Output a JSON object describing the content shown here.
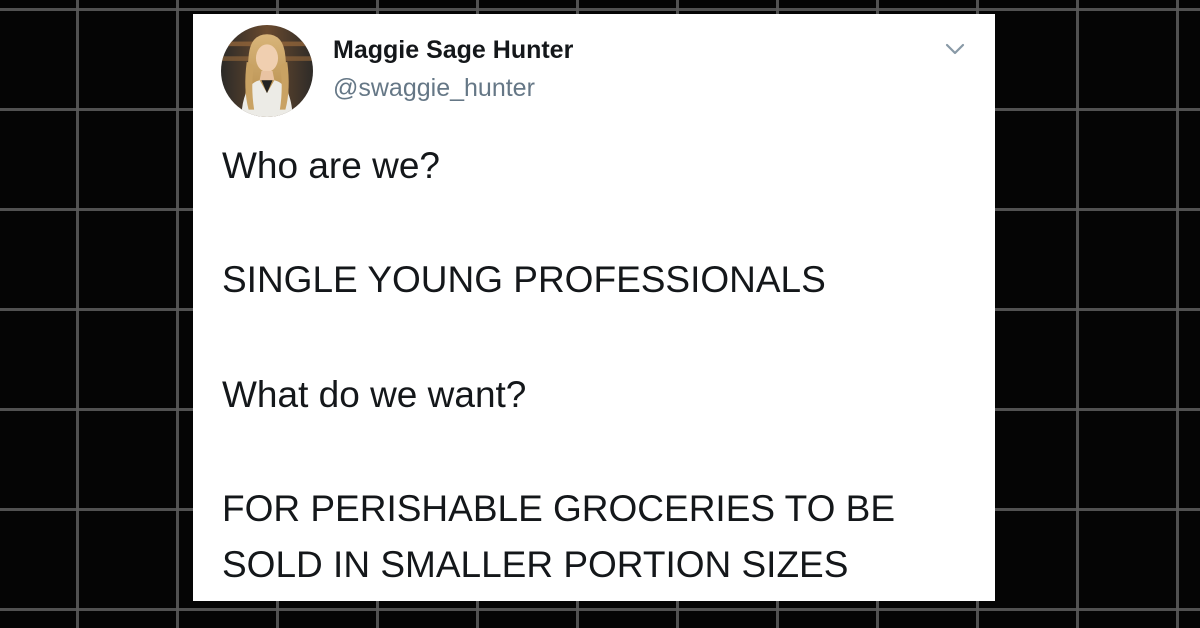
{
  "tweet": {
    "author": {
      "display_name": "Maggie Sage Hunter",
      "handle": "@swaggie_hunter"
    },
    "icons": {
      "avatar": "profile-photo",
      "more": "chevron-down-icon"
    },
    "lines": [
      "Who are we?",
      "SINGLE YOUNG PROFESSIONALS",
      "What do we want?",
      "FOR PERISHABLE GROCERIES TO BE",
      "SOLD IN SMALLER PORTION SIZES"
    ]
  },
  "colors": {
    "background": "#050505",
    "grid": "#5a5a5a",
    "card": "#ffffff",
    "text": "#14171a",
    "handle": "#657786",
    "chevron": "#8899a6"
  }
}
